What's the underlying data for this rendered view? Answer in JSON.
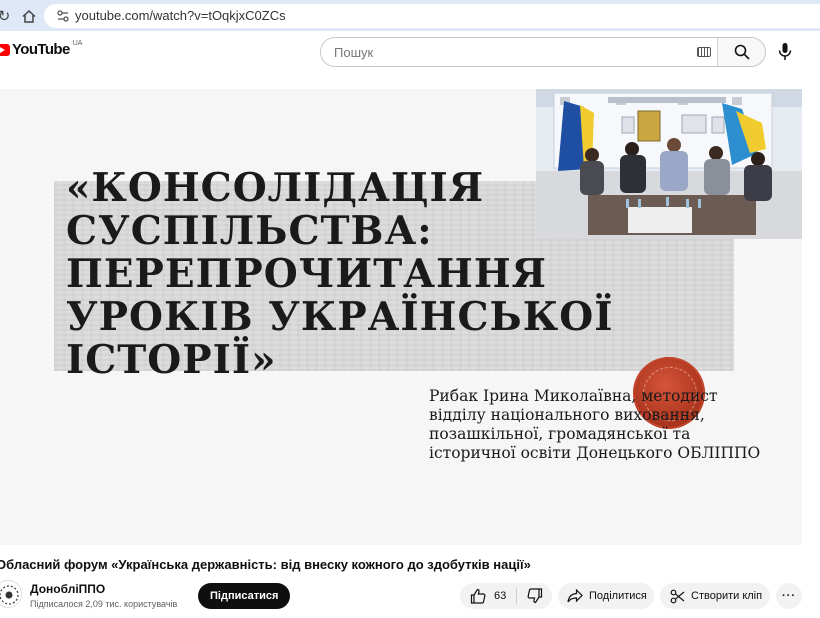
{
  "browser": {
    "url": "youtube.com/watch?v=tOqkjxC0ZCs"
  },
  "header": {
    "logo_text": "YouTube",
    "region": "UA",
    "search_placeholder": "Пошук"
  },
  "slide": {
    "title_lines": [
      "«Консолідація",
      "суспільства:",
      "перепрочитання",
      "уроків української",
      "історії»"
    ],
    "author_lines": [
      "Рибак Ірина Миколаївна, методист",
      "відділу національного виховання,",
      "позашкільної, громадянської та",
      "історичної освіти Донецького ОБЛІППО"
    ]
  },
  "video": {
    "title": "Обласний форум «Українська державність: від внеску кожного до здобутків нації»"
  },
  "channel": {
    "name": "ДонобліППО",
    "subscribers": "Підписалося 2,09 тис. користувачів",
    "subscribe_label": "Підписатися"
  },
  "actions": {
    "like_count": "63",
    "share_label": "Поділитися",
    "clip_label": "Створити кліп",
    "more_label": "···"
  },
  "colors": {
    "brand_red": "#ff0000",
    "subscribe_bg": "#0f0f0f",
    "seal_red": "#b33a22"
  }
}
